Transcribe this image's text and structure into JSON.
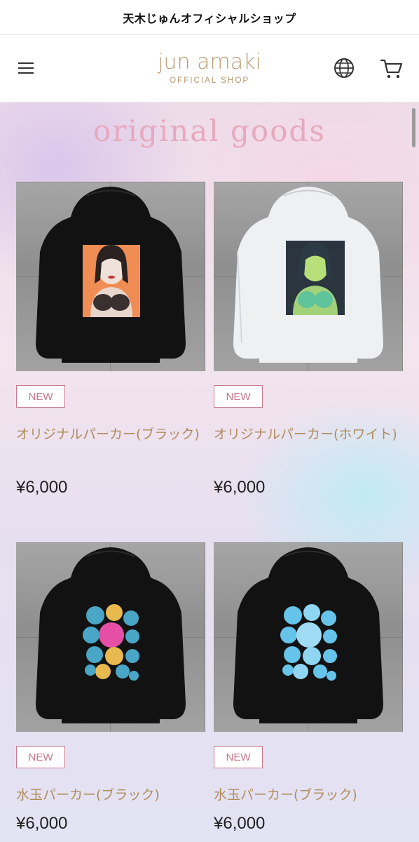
{
  "topbar": {
    "title": "天木じゅんオフィシャルショップ"
  },
  "header": {
    "logo_main": "jun amaki",
    "logo_sub": "OFFICIAL SHOP",
    "icons": [
      "menu-icon",
      "globe-icon",
      "cart-icon"
    ]
  },
  "section": {
    "title": "original goods"
  },
  "products": [
    {
      "badge": "NEW",
      "name": "オリジナルパーカー(ブラック)",
      "price": "¥6,000",
      "hoodie_color": "#121212",
      "print": "orange-portrait"
    },
    {
      "badge": "NEW",
      "name": "オリジナルパーカー(ホワイト)",
      "price": "¥6,000",
      "hoodie_color": "#eef0f2",
      "print": "green-portrait"
    },
    {
      "badge": "NEW",
      "name": "水玉パーカー(ブラック)",
      "price": "¥6,000",
      "hoodie_color": "#121212",
      "print": "colorful-dots"
    },
    {
      "badge": "NEW",
      "name": "水玉パーカー(ブラック)",
      "price": "¥6,000",
      "hoodie_color": "#121212",
      "print": "blue-dots"
    }
  ],
  "colors": {
    "accent_pink": "#c9798d",
    "title_pink": "#e7a9bd",
    "name_gold": "#b08c5e",
    "logo_gold": "#b89c73"
  }
}
